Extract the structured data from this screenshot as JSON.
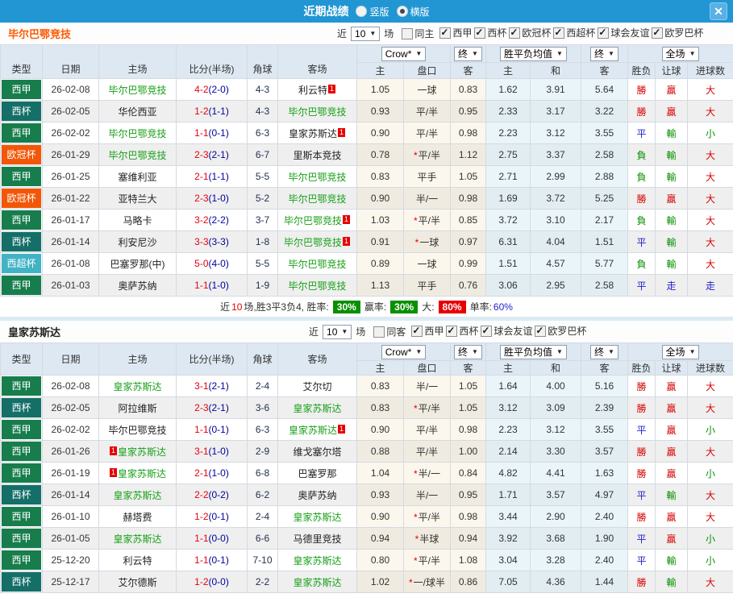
{
  "titlebar": {
    "title": "近期战绩",
    "vertical_label": "竖版",
    "horizontal_label": "横版",
    "selected_layout": "横版"
  },
  "selects": {
    "company": "Crow*",
    "final": "终",
    "avg": "胜平负均值",
    "scope": "全场"
  },
  "columns": {
    "type": "类型",
    "date": "日期",
    "home": "主场",
    "score": "比分(半场)",
    "corner": "角球",
    "away": "客场",
    "odds_home": "主",
    "odds_line": "盘口",
    "odds_away": "客",
    "avg_home": "主",
    "avg_draw": "和",
    "avg_away": "客",
    "result_wdl": "胜负",
    "result_handicap": "让球",
    "result_goals": "进球数"
  },
  "colors": {
    "titlebar": "#2196d3",
    "laliga_badge": "#177d4d",
    "copa_badge": "#136f68",
    "ucl_badge": "#f25708",
    "supercup_badge": "#41b3c5",
    "team1_name": "#ff5a00",
    "highlight_team": "#18a018",
    "win_text": "#d60000",
    "draw_text": "#2222cc",
    "lose_text": "#089000",
    "score_fulltime": "#e60012",
    "score_halftime": "#000099",
    "rate_green": "#089000",
    "rate_red": "#e80000"
  },
  "sections": [
    {
      "team": "毕尔巴鄂竞技",
      "near_label": "近",
      "near_value": "10",
      "unit_label": "场",
      "same_label": "同主",
      "same_checked": false,
      "leagues": [
        {
          "label": "西甲",
          "state": "checked"
        },
        {
          "label": "西杯",
          "state": "checked"
        },
        {
          "label": "欧冠杯",
          "state": "checked"
        },
        {
          "label": "西超杯",
          "state": "checked"
        },
        {
          "label": "球会友谊",
          "state": "checked"
        },
        {
          "label": "欧罗巴杯",
          "state": "checked"
        }
      ],
      "rows": [
        {
          "type": "西甲",
          "tclass": "liga",
          "date": "26-02-08",
          "home": "毕尔巴鄂竞技",
          "hcls": "t-green",
          "sft": "4-2",
          "sht": "(2-0)",
          "corner": "4-3",
          "away": "利云特",
          "acls": "t-dark",
          "apost": "1",
          "o1": "1.05",
          "line": "一球",
          "o2": "0.83",
          "a1": "1.62",
          "a2": "3.91",
          "a3": "5.64",
          "r1": "勝",
          "c1": "rw",
          "r2": "贏",
          "c2": "rw",
          "r3": "大",
          "c3": "rw"
        },
        {
          "type": "西杯",
          "tclass": "copa",
          "date": "26-02-05",
          "home": "华伦西亚",
          "hcls": "t-dark",
          "sft": "1-2",
          "sht": "(1-1)",
          "corner": "4-3",
          "away": "毕尔巴鄂竞技",
          "acls": "t-green",
          "o1": "0.93",
          "line": "平/半",
          "o2": "0.95",
          "a1": "2.33",
          "a2": "3.17",
          "a3": "3.22",
          "r1": "勝",
          "c1": "rw",
          "r2": "贏",
          "c2": "rw",
          "r3": "大",
          "c3": "rw"
        },
        {
          "type": "西甲",
          "tclass": "liga",
          "date": "26-02-02",
          "home": "毕尔巴鄂竞技",
          "hcls": "t-green",
          "sft": "1-1",
          "sht": "(0-1)",
          "corner": "6-3",
          "away": "皇家苏斯达",
          "acls": "t-dark",
          "apost": "1",
          "o1": "0.90",
          "line": "平/半",
          "o2": "0.98",
          "a1": "2.23",
          "a2": "3.12",
          "a3": "3.55",
          "r1": "平",
          "c1": "rd",
          "r2": "輸",
          "c2": "rl",
          "r3": "小",
          "c3": "rl"
        },
        {
          "type": "欧冠杯",
          "tclass": "ucl",
          "date": "26-01-29",
          "home": "毕尔巴鄂竞技",
          "hcls": "t-green",
          "sft": "2-3",
          "sht": "(2-1)",
          "corner": "6-7",
          "away": "里斯本竞技",
          "acls": "t-dark",
          "o1": "0.78",
          "star": "*",
          "line": "平/半",
          "o2": "1.12",
          "a1": "2.75",
          "a2": "3.37",
          "a3": "2.58",
          "r1": "負",
          "c1": "rl",
          "r2": "輸",
          "c2": "rl",
          "r3": "大",
          "c3": "rw"
        },
        {
          "type": "西甲",
          "tclass": "liga",
          "date": "26-01-25",
          "home": "塞维利亚",
          "hcls": "t-dark",
          "sft": "2-1",
          "sht": "(1-1)",
          "corner": "5-5",
          "away": "毕尔巴鄂竞技",
          "acls": "t-green",
          "o1": "0.83",
          "line": "平手",
          "o2": "1.05",
          "a1": "2.71",
          "a2": "2.99",
          "a3": "2.88",
          "r1": "負",
          "c1": "rl",
          "r2": "輸",
          "c2": "rl",
          "r3": "大",
          "c3": "rw"
        },
        {
          "type": "欧冠杯",
          "tclass": "ucl",
          "date": "26-01-22",
          "home": "亚特兰大",
          "hcls": "t-dark",
          "sft": "2-3",
          "sht": "(1-0)",
          "corner": "5-2",
          "away": "毕尔巴鄂竞技",
          "acls": "t-green",
          "o1": "0.90",
          "line": "半/一",
          "o2": "0.98",
          "a1": "1.69",
          "a2": "3.72",
          "a3": "5.25",
          "r1": "勝",
          "c1": "rw",
          "r2": "贏",
          "c2": "rw",
          "r3": "大",
          "c3": "rw"
        },
        {
          "type": "西甲",
          "tclass": "liga",
          "date": "26-01-17",
          "home": "马略卡",
          "hcls": "t-dark",
          "sft": "3-2",
          "sht": "(2-2)",
          "corner": "3-7",
          "away": "毕尔巴鄂竞技",
          "acls": "t-green",
          "apost": "1",
          "o1": "1.03",
          "star": "*",
          "line": "平/半",
          "o2": "0.85",
          "a1": "3.72",
          "a2": "3.10",
          "a3": "2.17",
          "r1": "負",
          "c1": "rl",
          "r2": "輸",
          "c2": "rl",
          "r3": "大",
          "c3": "rw"
        },
        {
          "type": "西杯",
          "tclass": "copa",
          "date": "26-01-14",
          "home": "利安尼沙",
          "hcls": "t-dark",
          "sft": "3-3",
          "sht": "(3-3)",
          "corner": "1-8",
          "away": "毕尔巴鄂竞技",
          "acls": "t-green",
          "apost": "1",
          "o1": "0.91",
          "star": "*",
          "line": "一球",
          "o2": "0.97",
          "a1": "6.31",
          "a2": "4.04",
          "a3": "1.51",
          "r1": "平",
          "c1": "rd",
          "r2": "輸",
          "c2": "rl",
          "r3": "大",
          "c3": "rw"
        },
        {
          "type": "西超杯",
          "tclass": "sup",
          "date": "26-01-08",
          "home": "巴塞罗那(中)",
          "hcls": "t-dark",
          "sft": "5-0",
          "sht": "(4-0)",
          "corner": "5-5",
          "away": "毕尔巴鄂竞技",
          "acls": "t-green",
          "o1": "0.89",
          "line": "一球",
          "o2": "0.99",
          "a1": "1.51",
          "a2": "4.57",
          "a3": "5.77",
          "r1": "負",
          "c1": "rl",
          "r2": "輸",
          "c2": "rl",
          "r3": "大",
          "c3": "rw"
        },
        {
          "type": "西甲",
          "tclass": "liga",
          "date": "26-01-03",
          "home": "奥萨苏纳",
          "hcls": "t-dark",
          "sft": "1-1",
          "sht": "(1-0)",
          "corner": "1-9",
          "away": "毕尔巴鄂竞技",
          "acls": "t-green",
          "o1": "1.13",
          "line": "平手",
          "o2": "0.76",
          "a1": "3.06",
          "a2": "2.95",
          "a3": "2.58",
          "r1": "平",
          "c1": "rd",
          "r2": "走",
          "c2": "rd",
          "r3": "走",
          "c3": "rd"
        }
      ],
      "summary": {
        "p1": "近",
        "count": "10",
        "p2": "场,胜3平3负4, 胜率:",
        "win_rate": "30%",
        "p3": "赢率:",
        "handicap_win_rate": "30%",
        "p4": "大:",
        "over_rate": "80%",
        "p5": "单率:",
        "single_rate": "60%"
      }
    },
    {
      "team": "皇家苏斯达",
      "near_label": "近",
      "near_value": "10",
      "unit_label": "场",
      "same_label": "同客",
      "same_checked": false,
      "leagues": [
        {
          "label": "西甲",
          "state": "checked"
        },
        {
          "label": "西杯",
          "state": "checked"
        },
        {
          "label": "球会友谊",
          "state": "checked"
        },
        {
          "label": "欧罗巴杯",
          "state": "checked"
        }
      ],
      "rows": [
        {
          "type": "西甲",
          "tclass": "liga",
          "date": "26-02-08",
          "home": "皇家苏斯达",
          "hcls": "t-green",
          "sft": "3-1",
          "sht": "(2-1)",
          "corner": "2-4",
          "away": "艾尔切",
          "acls": "t-dark",
          "o1": "0.83",
          "line": "半/一",
          "o2": "1.05",
          "a1": "1.64",
          "a2": "4.00",
          "a3": "5.16",
          "r1": "勝",
          "c1": "rw",
          "r2": "贏",
          "c2": "rw",
          "r3": "大",
          "c3": "rw"
        },
        {
          "type": "西杯",
          "tclass": "copa",
          "date": "26-02-05",
          "home": "阿拉维斯",
          "hcls": "t-dark",
          "sft": "2-3",
          "sht": "(2-1)",
          "corner": "3-6",
          "away": "皇家苏斯达",
          "acls": "t-green",
          "o1": "0.83",
          "star": "*",
          "line": "平/半",
          "o2": "1.05",
          "a1": "3.12",
          "a2": "3.09",
          "a3": "2.39",
          "r1": "勝",
          "c1": "rw",
          "r2": "贏",
          "c2": "rw",
          "r3": "大",
          "c3": "rw"
        },
        {
          "type": "西甲",
          "tclass": "liga",
          "date": "26-02-02",
          "home": "毕尔巴鄂竞技",
          "hcls": "t-dark",
          "sft": "1-1",
          "sht": "(0-1)",
          "corner": "6-3",
          "away": "皇家苏斯达",
          "acls": "t-green",
          "apost": "1",
          "o1": "0.90",
          "line": "平/半",
          "o2": "0.98",
          "a1": "2.23",
          "a2": "3.12",
          "a3": "3.55",
          "r1": "平",
          "c1": "rd",
          "r2": "贏",
          "c2": "rw",
          "r3": "小",
          "c3": "rl"
        },
        {
          "type": "西甲",
          "tclass": "liga",
          "date": "26-01-26",
          "hpre": "1",
          "home": "皇家苏斯达",
          "hcls": "t-green",
          "sft": "3-1",
          "sht": "(1-0)",
          "corner": "2-9",
          "away": "维戈塞尔塔",
          "acls": "t-dark",
          "o1": "0.88",
          "line": "平/半",
          "o2": "1.00",
          "a1": "2.14",
          "a2": "3.30",
          "a3": "3.57",
          "r1": "勝",
          "c1": "rw",
          "r2": "贏",
          "c2": "rw",
          "r3": "大",
          "c3": "rw"
        },
        {
          "type": "西甲",
          "tclass": "liga",
          "date": "26-01-19",
          "hpre": "1",
          "home": "皇家苏斯达",
          "hcls": "t-green",
          "sft": "2-1",
          "sht": "(1-0)",
          "corner": "6-8",
          "away": "巴塞罗那",
          "acls": "t-dark",
          "o1": "1.04",
          "star": "*",
          "line": "半/一",
          "o2": "0.84",
          "a1": "4.82",
          "a2": "4.41",
          "a3": "1.63",
          "r1": "勝",
          "c1": "rw",
          "r2": "贏",
          "c2": "rw",
          "r3": "小",
          "c3": "rl"
        },
        {
          "type": "西杯",
          "tclass": "copa",
          "date": "26-01-14",
          "home": "皇家苏斯达",
          "hcls": "t-green",
          "sft": "2-2",
          "sht": "(0-2)",
          "corner": "6-2",
          "away": "奥萨苏纳",
          "acls": "t-dark",
          "o1": "0.93",
          "line": "半/一",
          "o2": "0.95",
          "a1": "1.71",
          "a2": "3.57",
          "a3": "4.97",
          "r1": "平",
          "c1": "rd",
          "r2": "輸",
          "c2": "rl",
          "r3": "大",
          "c3": "rw"
        },
        {
          "type": "西甲",
          "tclass": "liga",
          "date": "26-01-10",
          "home": "赫塔费",
          "hcls": "t-dark",
          "sft": "1-2",
          "sht": "(0-1)",
          "corner": "2-4",
          "away": "皇家苏斯达",
          "acls": "t-green",
          "o1": "0.90",
          "star": "*",
          "line": "平/半",
          "o2": "0.98",
          "a1": "3.44",
          "a2": "2.90",
          "a3": "2.40",
          "r1": "勝",
          "c1": "rw",
          "r2": "贏",
          "c2": "rw",
          "r3": "大",
          "c3": "rw"
        },
        {
          "type": "西甲",
          "tclass": "liga",
          "date": "26-01-05",
          "home": "皇家苏斯达",
          "hcls": "t-green",
          "sft": "1-1",
          "sht": "(0-0)",
          "corner": "6-6",
          "away": "马德里竞技",
          "acls": "t-dark",
          "o1": "0.94",
          "star": "*",
          "line": "半球",
          "o2": "0.94",
          "a1": "3.92",
          "a2": "3.68",
          "a3": "1.90",
          "r1": "平",
          "c1": "rd",
          "r2": "贏",
          "c2": "rw",
          "r3": "小",
          "c3": "rl"
        },
        {
          "type": "西甲",
          "tclass": "liga",
          "date": "25-12-20",
          "home": "利云特",
          "hcls": "t-dark",
          "sft": "1-1",
          "sht": "(0-1)",
          "corner": "7-10",
          "away": "皇家苏斯达",
          "acls": "t-green",
          "o1": "0.80",
          "star": "*",
          "line": "平/半",
          "o2": "1.08",
          "a1": "3.04",
          "a2": "3.28",
          "a3": "2.40",
          "r1": "平",
          "c1": "rd",
          "r2": "輸",
          "c2": "rl",
          "r3": "小",
          "c3": "rl"
        },
        {
          "type": "西杯",
          "tclass": "copa",
          "date": "25-12-17",
          "home": "艾尔德斯",
          "hcls": "t-dark",
          "sft": "1-2",
          "sht": "(0-0)",
          "corner": "2-2",
          "away": "皇家苏斯达",
          "acls": "t-green",
          "o1": "1.02",
          "star": "*",
          "line": "一/球半",
          "o2": "0.86",
          "a1": "7.05",
          "a2": "4.36",
          "a3": "1.44",
          "r1": "勝",
          "c1": "rw",
          "r2": "輸",
          "c2": "rl",
          "r3": "大",
          "c3": "rw"
        }
      ]
    }
  ]
}
